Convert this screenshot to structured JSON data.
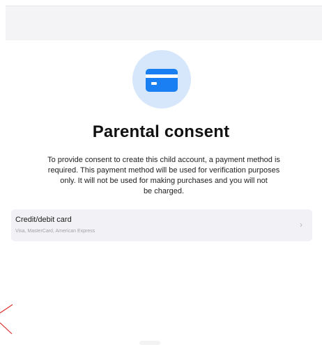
{
  "consent": {
    "title": "Parental consent",
    "description_lines": [
      "To provide consent to create this child account, a payment method is",
      "required. This payment method will be used for verification purposes",
      "only. It will not be used for making purchases and you will not",
      "be charged."
    ]
  },
  "payment_option": {
    "title": "Credit/debit card",
    "subtitle": "Visa, MasterCard, American Express",
    "chevron": "›"
  },
  "icons": {
    "header_icon": "credit-card-icon",
    "chevron": "chevron-right-icon"
  },
  "colors": {
    "accent": "#1a7ff2",
    "icon_circle_bg": "#d7e7fb",
    "option_bg": "#f2f2f6",
    "annotation_red": "#e03030"
  }
}
